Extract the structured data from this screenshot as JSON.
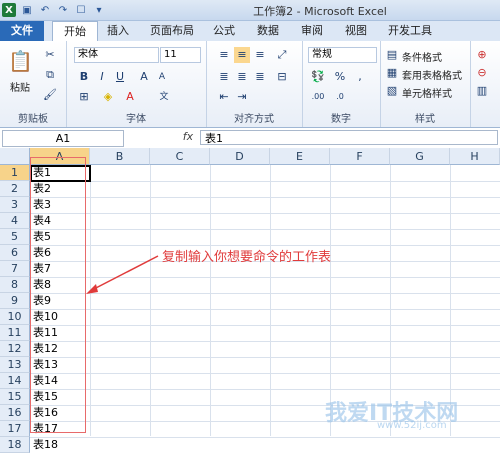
{
  "window": {
    "title": "工作簿2 - Microsoft Excel"
  },
  "tabs": [
    {
      "label": "文件"
    },
    {
      "label": "开始"
    },
    {
      "label": "插入"
    },
    {
      "label": "页面布局"
    },
    {
      "label": "公式"
    },
    {
      "label": "数据"
    },
    {
      "label": "审阅"
    },
    {
      "label": "视图"
    },
    {
      "label": "开发工具"
    }
  ],
  "ribbon": {
    "clipboard": {
      "paste_label": "粘贴",
      "group_label": "剪贴板"
    },
    "font": {
      "font_name": "宋体",
      "font_size": "11",
      "group_label": "字体"
    },
    "alignment": {
      "group_label": "对齐方式"
    },
    "number": {
      "format": "常规",
      "group_label": "数字"
    },
    "styles": {
      "cond_format": "条件格式",
      "table_format": "套用表格格式",
      "cell_style": "单元格样式",
      "group_label": "样式"
    }
  },
  "formula_bar": {
    "name_box": "A1",
    "fx": "fx",
    "content": "表1"
  },
  "grid": {
    "columns": [
      "A",
      "B",
      "C",
      "D",
      "E",
      "F",
      "G",
      "H"
    ],
    "rows": [
      "1",
      "2",
      "3",
      "4",
      "5",
      "6",
      "7",
      "8",
      "9",
      "10",
      "11",
      "12",
      "13",
      "14",
      "15",
      "16",
      "17",
      "18"
    ],
    "column_a": [
      "表1",
      "表2",
      "表3",
      "表4",
      "表5",
      "表6",
      "表7",
      "表8",
      "表9",
      "表10",
      "表11",
      "表12",
      "表13",
      "表14",
      "表15",
      "表16",
      "表17",
      "表18"
    ]
  },
  "annotation": {
    "text": "复制输入你想要命令的工作表",
    "color": "#e03b3b"
  },
  "watermark": {
    "text": "我爱IT技术网",
    "sub": "www.52ij.com"
  }
}
